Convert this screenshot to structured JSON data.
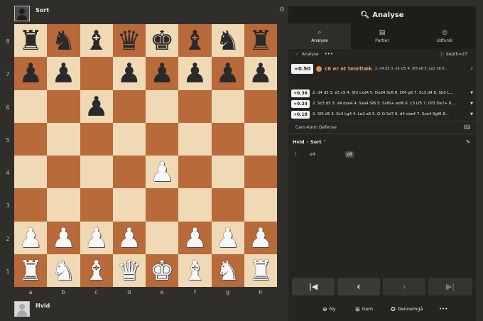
{
  "top_player": {
    "name": "Sort"
  },
  "bottom_player": {
    "name": "Hvid"
  },
  "board": {
    "ranks": [
      "8",
      "7",
      "6",
      "5",
      "4",
      "3",
      "2",
      "1"
    ],
    "files": [
      "a",
      "b",
      "c",
      "d",
      "e",
      "f",
      "g",
      "h"
    ],
    "position": [
      [
        "br",
        "bn",
        "bb",
        "bq",
        "bk",
        "bb",
        "bn",
        "br"
      ],
      [
        "bp",
        "bp",
        "",
        "bp",
        "bp",
        "bp",
        "bp",
        "bp"
      ],
      [
        "",
        "",
        "bp",
        "",
        "",
        "",
        "",
        ""
      ],
      [
        "",
        "",
        "",
        "",
        "",
        "",
        "",
        ""
      ],
      [
        "",
        "",
        "",
        "",
        "wp",
        "",
        "",
        ""
      ],
      [
        "",
        "",
        "",
        "",
        "",
        "",
        "",
        ""
      ],
      [
        "wp",
        "wp",
        "wp",
        "wp",
        "",
        "wp",
        "wp",
        "wp"
      ],
      [
        "wr",
        "wn",
        "wb",
        "wq",
        "wk",
        "wb",
        "wn",
        "wr"
      ]
    ]
  },
  "panel": {
    "title": "Analyse",
    "tabs": [
      {
        "label": "Analyse",
        "icon": "search-icon",
        "active": true
      },
      {
        "label": "Partier",
        "icon": "games-icon",
        "active": false
      },
      {
        "label": "Udforsk",
        "icon": "compass-icon",
        "active": false
      }
    ],
    "toolbar": {
      "toggle_label": "Analyse",
      "more": "•••",
      "depth": "depth=27"
    },
    "eval": {
      "score": "+0.50",
      "move_text": "c6 er et teoritæk",
      "line": "2. d4 d5 3. e5 Lf5 4. Sf3 e6 5. Le2 h6 6..."
    },
    "lines": [
      {
        "score": "+0.36",
        "moves": "2. d4 d5 3. e5 c5 4. Sf3 cxd4 5. Dxd4 Sc6 6. Df4 g6 7. Sc3 d4 8. Sb5 L..."
      },
      {
        "score": "+0.24",
        "moves": "2. Sc3 d5 3. d4 dxe4 4. Sxe4 Sf6 5. Sxf6+ exf6 6. c3 Lf5 7. Df3 De7+ 8..."
      },
      {
        "score": "+0.18",
        "moves": "2. Sf3 d5 3. Sc3 Lg4 4. Le2 e6 5. O-O Sd7 6. d4 dxe4 7. Sxe4 Sgf6 8..."
      }
    ],
    "opening": "Caro-Kann Defense",
    "movelist_header": {
      "white": "Hvid",
      "dot": "·",
      "black": "Sort",
      "caret": "˅"
    },
    "moves": [
      {
        "num": "1.",
        "white": "e4",
        "black": "c6"
      }
    ],
    "nav": {
      "first": "⏮",
      "prev": "‹",
      "next": "›",
      "last": "⏭"
    },
    "footer": [
      {
        "label": "Ny",
        "icon": "new-search-icon"
      },
      {
        "label": "Gem",
        "icon": "save-icon"
      },
      {
        "label": "Gennemgå",
        "icon": "review-star-icon"
      }
    ],
    "footer_more": "•••"
  }
}
